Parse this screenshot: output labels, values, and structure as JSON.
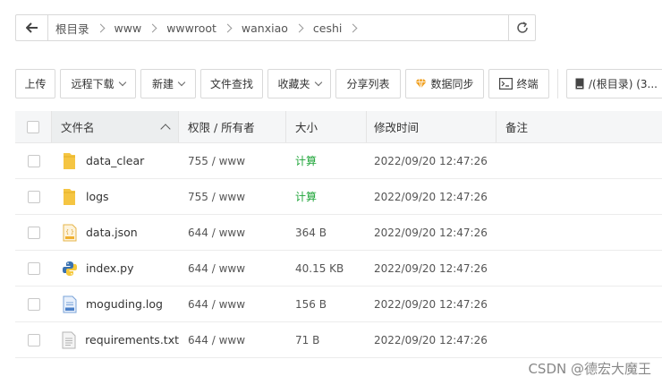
{
  "path": {
    "crumbs": [
      "根目录",
      "www",
      "wwwroot",
      "wanxiao",
      "ceshi"
    ]
  },
  "toolbar": {
    "upload": "上传",
    "remote_download": "远程下载",
    "new": "新建",
    "file_search": "文件查找",
    "favorites": "收藏夹",
    "share_list": "分享列表",
    "sync": "数据同步",
    "terminal": "终端",
    "disk": "/(根目录) (3..."
  },
  "table": {
    "headers": {
      "name": "文件名",
      "perm": "权限 / 所有者",
      "size": "大小",
      "time": "修改时间",
      "note": "备注"
    },
    "rows": [
      {
        "name": "data_clear",
        "icon": "folder-icon",
        "perm": "755 / www",
        "size": "计算",
        "time": "2022/09/20 12:47:26"
      },
      {
        "name": "logs",
        "icon": "folder-icon",
        "perm": "755 / www",
        "size": "计算",
        "time": "2022/09/20 12:47:26"
      },
      {
        "name": "data.json",
        "icon": "json-file-icon",
        "perm": "644 / www",
        "size": "364 B",
        "time": "2022/09/20 12:47:26"
      },
      {
        "name": "index.py",
        "icon": "python-file-icon",
        "perm": "644 / www",
        "size": "40.15 KB",
        "time": "2022/09/20 12:47:26"
      },
      {
        "name": "moguding.log",
        "icon": "log-file-icon",
        "perm": "644 / www",
        "size": "156 B",
        "time": "2022/09/20 12:47:26"
      },
      {
        "name": "requirements.txt",
        "icon": "text-file-icon",
        "perm": "644 / www",
        "size": "71 B",
        "time": "2022/09/20 12:47:26"
      }
    ]
  },
  "watermark": "CSDN @德宏大魔王",
  "colors": {
    "calc_green": "#20a53a",
    "folder_yellow": "#f5c542",
    "sync_orange": "#f0a020"
  }
}
